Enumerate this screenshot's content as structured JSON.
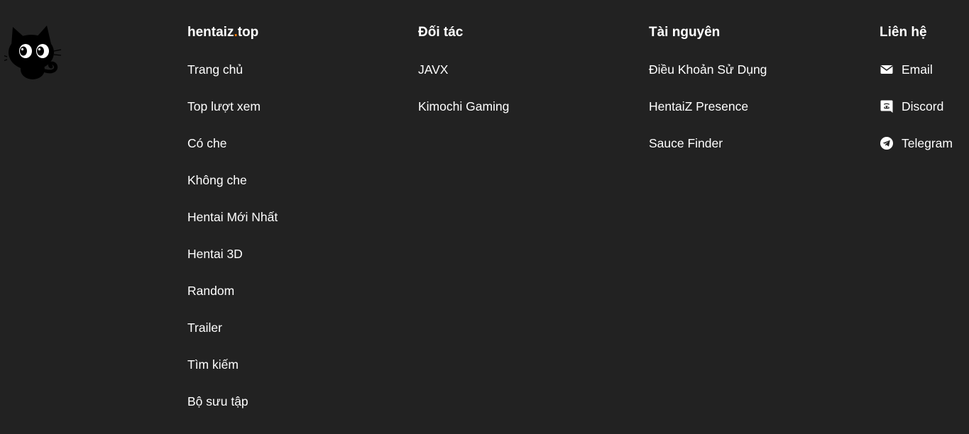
{
  "brand": {
    "name_main": "hentaiz",
    "name_dot": ".",
    "name_tld": "top",
    "logo_icon": "black-cat-logo"
  },
  "columns": {
    "site": {
      "items": [
        "Trang chủ",
        "Top lượt xem",
        "Có che",
        "Không che",
        "Hentai Mới Nhất",
        "Hentai 3D",
        "Random",
        "Trailer",
        "Tìm kiếm",
        "Bộ sưu tập"
      ]
    },
    "partners": {
      "title": "Đối tác",
      "items": [
        "JAVX",
        "Kimochi Gaming"
      ]
    },
    "resources": {
      "title": "Tài nguyên",
      "items": [
        "Điều Khoản Sử Dụng",
        "HentaiZ Presence",
        "Sauce Finder"
      ]
    },
    "contact": {
      "title": "Liên hệ",
      "items": [
        {
          "label": "Email",
          "icon": "envelope-icon"
        },
        {
          "label": "Discord",
          "icon": "discord-icon"
        },
        {
          "label": "Telegram",
          "icon": "telegram-icon"
        }
      ]
    }
  },
  "colors": {
    "background": "#222222",
    "text": "#ffffff",
    "accent_dot": "#ff7a00"
  }
}
